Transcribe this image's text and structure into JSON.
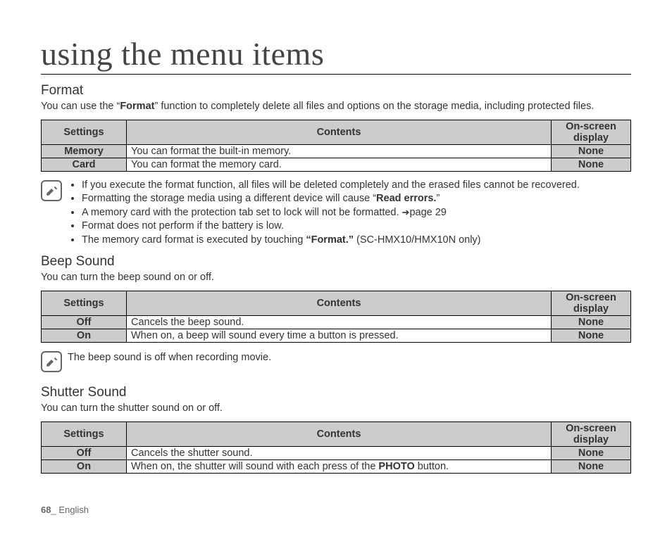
{
  "title": "using the menu items",
  "sections": {
    "format": {
      "heading": "Format",
      "desc_pre": "You can use the “",
      "desc_bold": "Format",
      "desc_post": "” function to completely delete all files and options on the storage media, including protected files.",
      "headers": {
        "settings": "Settings",
        "contents": "Contents",
        "display_l1": "On-screen",
        "display_l2": "display"
      },
      "rows": [
        {
          "setting": "Memory",
          "content": "You can format the built-in memory.",
          "display": "None"
        },
        {
          "setting": "Card",
          "content": "You can format the memory card.",
          "display": "None"
        }
      ],
      "notes": {
        "n1": "If you execute the format function, all files will be deleted completely and the erased files cannot be recovered.",
        "n2_pre": "Formatting the storage media using a different device will cause “",
        "n2_bold": "Read errors.",
        "n2_post": "”",
        "n3_pre": "A memory card with the protection tab set to lock will not be formatted. ",
        "n3_post": "page 29",
        "n4": "Format does not perform if the battery is low.",
        "n5_pre": "The memory card format is executed by touching ",
        "n5_bold": "“Format.”",
        "n5_post": " (SC-HMX10/HMX10N only)"
      }
    },
    "beep": {
      "heading": "Beep Sound",
      "desc": "You can turn the beep sound on or off.",
      "headers": {
        "settings": "Settings",
        "contents": "Contents",
        "display_l1": "On-screen",
        "display_l2": "display"
      },
      "rows": [
        {
          "setting": "Off",
          "content": "Cancels the beep sound.",
          "display": "None"
        },
        {
          "setting": "On",
          "content": "When on, a beep will sound every time a button is pressed.",
          "display": "None"
        }
      ],
      "note": "The beep sound is off when recording movie."
    },
    "shutter": {
      "heading": "Shutter Sound",
      "desc": "You can turn the shutter sound on or off.",
      "headers": {
        "settings": "Settings",
        "contents": "Contents",
        "display_l1": "On-screen",
        "display_l2": "display"
      },
      "rows": [
        {
          "setting": "Off",
          "content_pre": "Cancels the shutter sound.",
          "content_bold": "",
          "content_post": "",
          "display": "None"
        },
        {
          "setting": "On",
          "content_pre": "When on, the shutter will sound with each press of the ",
          "content_bold": "PHOTO",
          "content_post": " button.",
          "display": "None"
        }
      ]
    }
  },
  "footer": {
    "page": "68",
    "sep": "_ ",
    "lang": "English"
  }
}
